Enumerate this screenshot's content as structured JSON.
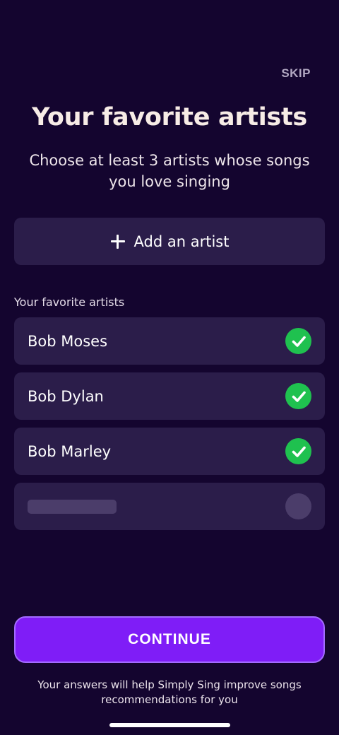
{
  "header": {
    "skip_label": "SKIP",
    "title": "Your favorite artists",
    "subtitle": "Choose at least 3 artists whose songs you love singing"
  },
  "add_artist": {
    "label": "Add an artist",
    "icon": "plus-icon"
  },
  "favorites": {
    "section_label": "Your favorite artists",
    "artists": [
      {
        "name": "Bob Moses",
        "selected": true
      },
      {
        "name": "Bob Dylan",
        "selected": true
      },
      {
        "name": "Bob Marley",
        "selected": true
      }
    ],
    "placeholder_count": 1
  },
  "footer": {
    "continue_label": "CONTINUE",
    "note": "Your answers will help Simply Sing improve songs recommendations for you"
  },
  "colors": {
    "background": "#14052f",
    "card": "#2b1d4a",
    "accent": "#7f1df7",
    "check": "#1fc14f"
  }
}
